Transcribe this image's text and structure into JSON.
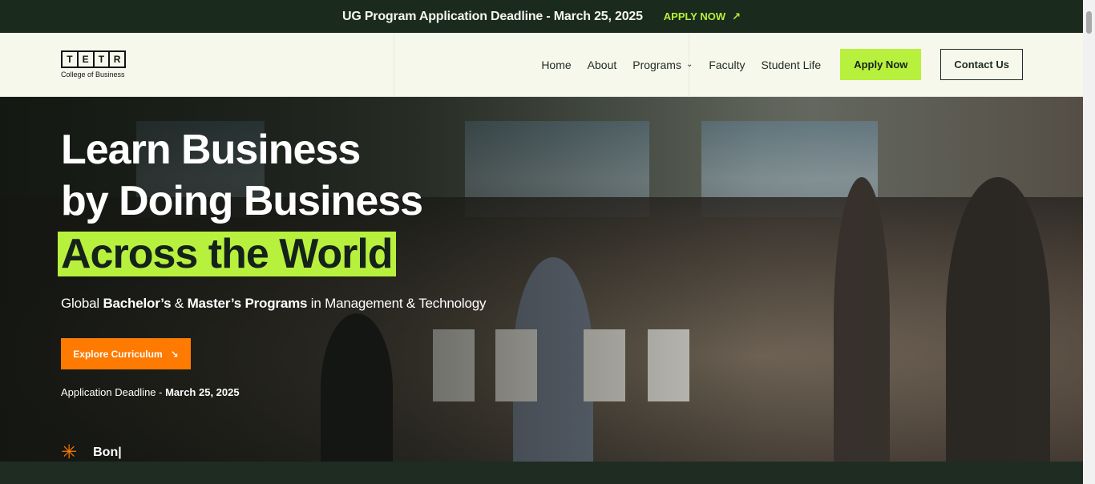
{
  "announcement": {
    "message": "UG Program Application Deadline - March 25, 2025",
    "cta": "APPLY NOW",
    "cta_icon": "arrow-up-right-icon"
  },
  "header": {
    "logo": {
      "letters": [
        "T",
        "E",
        "T",
        "R"
      ],
      "tagline": "College of Business"
    },
    "nav": {
      "home": "Home",
      "about": "About",
      "programs": "Programs",
      "faculty": "Faculty",
      "student_life": "Student Life"
    },
    "apply_now": "Apply Now",
    "contact_us": "Contact Us"
  },
  "hero": {
    "title_line1": "Learn Business",
    "title_line2": "by Doing Business",
    "highlight": "Across the World",
    "subtitle": {
      "p1": "Global ",
      "b1": "Bachelor’s",
      "p2": " & ",
      "b2": "Master’s Programs",
      "p3": " in Management & Technology"
    },
    "explore_button": "Explore Curriculum",
    "deadline_label": "Application Deadline - ",
    "deadline_date": "March 25, 2025",
    "typing_text": "Bon|"
  },
  "colors": {
    "accent_green": "#b8f03e",
    "accent_orange": "#ff7a00",
    "dark": "#1a2a1c"
  }
}
